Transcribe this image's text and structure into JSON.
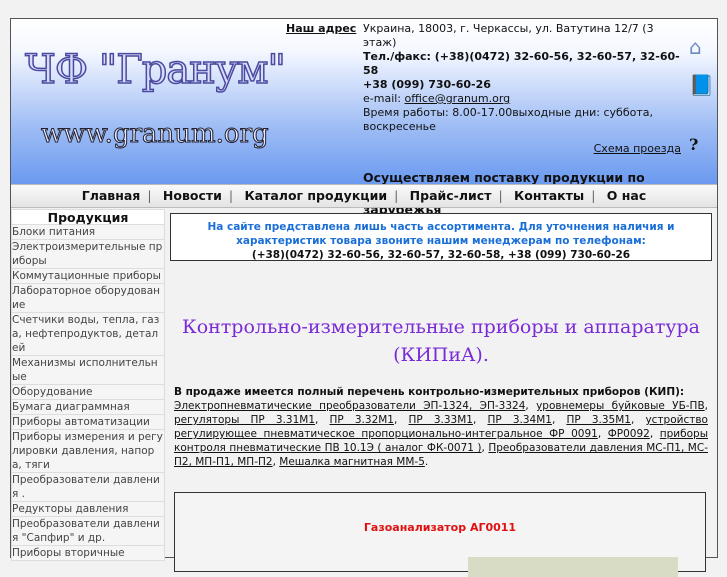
{
  "header": {
    "logo_title": "ЧФ \"Гранум\"",
    "logo_url": "www.granum.org",
    "address_label": "Наш адрес",
    "address": "Украина, 18003, г. Черкассы, ул. Ватутина 12/7 (3 этаж)",
    "phone": "Тел./факс: (+38)(0472) 32-60-56, 32-60-57, 32-60-58",
    "mobile": "+38 (099) 730-60-26",
    "email_label": "e-mail: ",
    "email": "office@granum.org",
    "hours": "Время работы:   8.00-17.00выходные дни: суббота, воскресенье",
    "route_link": "Схема проезда",
    "slogan": "Осуществляем поставку продукции по Украине и в страны ближнего и дальнего зарубежья"
  },
  "nav": [
    "Главная",
    "Новости",
    "Каталог продукции",
    "Прайс-лист",
    "Контакты",
    "О нас"
  ],
  "sidebar": {
    "title": "Продукция",
    "items": [
      "Блоки питания",
      "Электроизмерительные приборы",
      "Коммутационные приборы",
      "Лабораторное оборудование",
      "Счетчики воды, тепла, газа, нефтепродуктов, деталей",
      "Механизмы исполнительные",
      "Оборудование",
      "Бумага диаграммная",
      "Приборы автоматизации",
      "Приборы измерения и регулировки давления, напора, тяги",
      "Преобразователи давления .",
      "Редукторы давления",
      "Преобразователи давления \"Сапфир\" и др.",
      "Приборы вторичные"
    ]
  },
  "main": {
    "notice": "На сайте представлена лишь часть ассортимента. Для уточнения наличия и характеристик товара звоните нашим менеджерам по телефонам:",
    "notice_phones": "(+38)(0472) 32-60-56, 32-60-57, 32-60-58, +38 (099) 730-60-26",
    "title": "Контрольно-измерительные приборы и аппаратура (КИПиА).",
    "intro": "В продаже имеется полный перечень контрольно-измерительных приборов (КИП):",
    "links": [
      "Электропневматические преобразователи ЭП-1324, ЭП-3324",
      "уровнемеры буйковые УБ-ПВ",
      "регуляторы ПР 3.31М1",
      "ПР 3.32М1",
      "ПР 3.33М1",
      "ПР 3.34М1",
      "ПР 3.35М1",
      "устройство регулирующее пневматическое пропорционально-интегральное ФР 0091",
      "ФР0092",
      "приборы контроля пневматические ПВ 10.1Э ( аналог ФК-0071 )",
      "Преобразователи давления МС-П1, МС-П2, МП-П1, МП-П2",
      "Мешалка магнитная ММ-5"
    ],
    "product_title": "Газоанализатор АГ0011"
  }
}
